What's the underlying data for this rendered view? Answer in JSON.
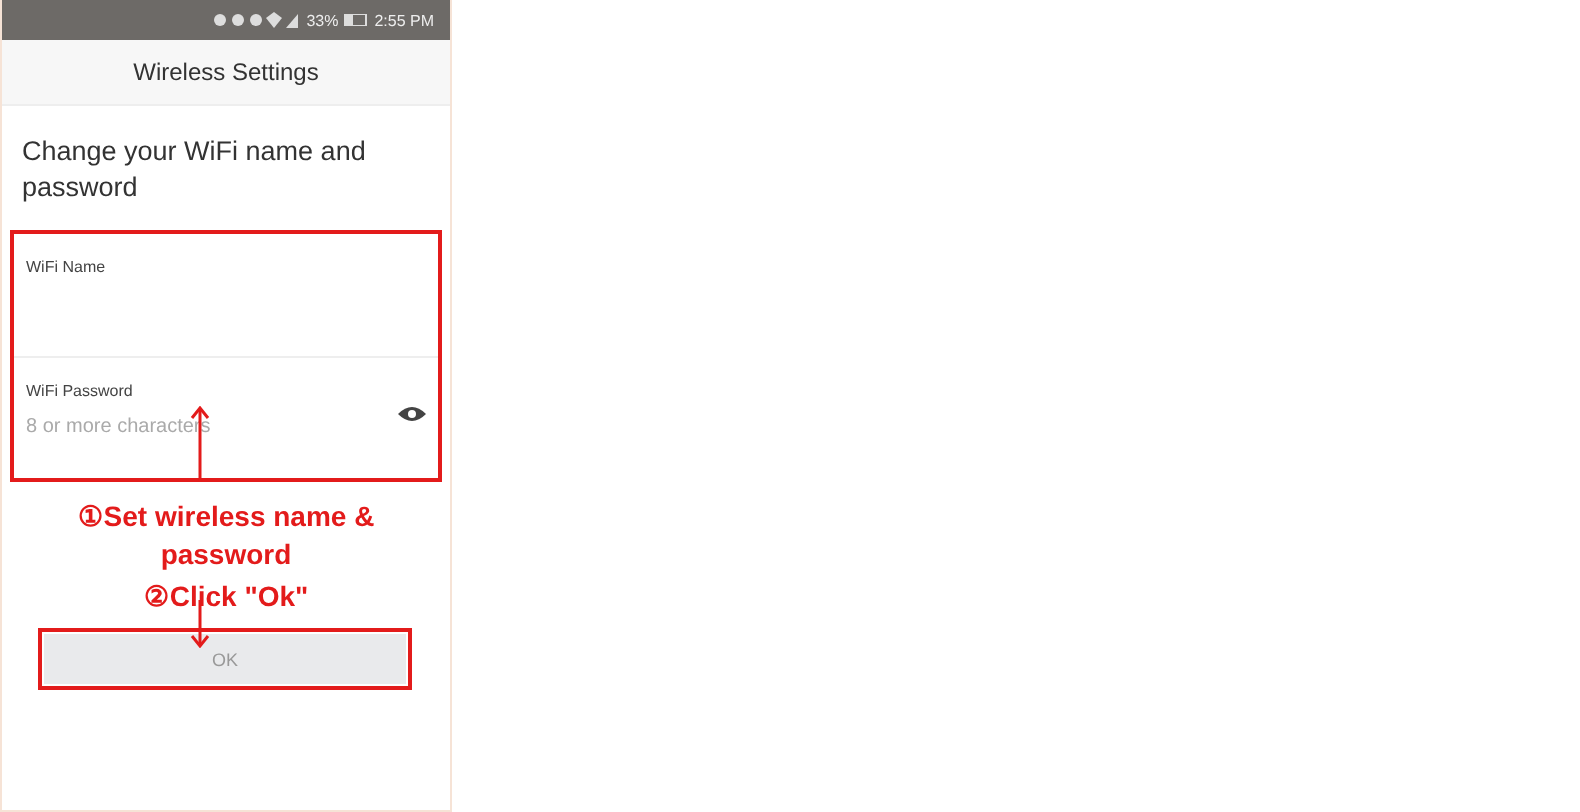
{
  "status_bar": {
    "battery": "33%",
    "time": "2:55 PM"
  },
  "header": {
    "title": "Wireless Settings"
  },
  "heading": "Change your WiFi name and password",
  "fields": [
    {
      "label": "WiFi Name",
      "kind": "text"
    },
    {
      "label": "WiFi Password",
      "placeholder": "8 or more characters",
      "kind": "password"
    }
  ],
  "annotations": [
    "①Set wireless name & password",
    "②Click \"Ok\""
  ],
  "ok_button": {
    "label": "OK",
    "disabled": true
  }
}
